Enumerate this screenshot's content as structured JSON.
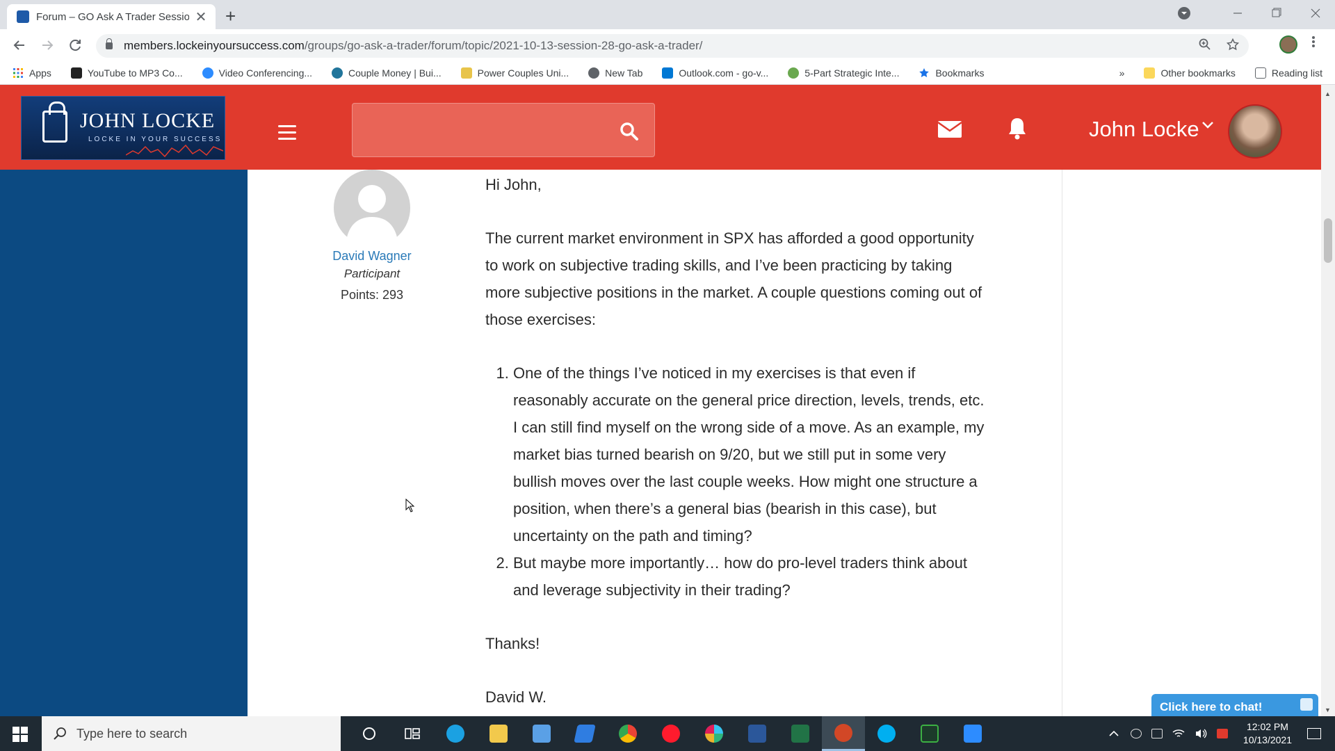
{
  "browser": {
    "tab_title": "Forum – GO Ask A Trader Session",
    "new_tab_symbol": "+",
    "close_symbol": "✕",
    "url_host": "members.lockeinyoursuccess.com",
    "url_path": "/groups/go-ask-a-trader/forum/topic/2021-10-13-session-28-go-ask-a-trader/",
    "bookmarks": [
      {
        "label": "Apps",
        "color": "#4285f4"
      },
      {
        "label": "YouTube to MP3 Co...",
        "color": "#222222"
      },
      {
        "label": "Video Conferencing...",
        "color": "#2d8cff"
      },
      {
        "label": "Couple Money | Bui...",
        "color": "#21759b"
      },
      {
        "label": "Power Couples Uni...",
        "color": "#e8c44a"
      },
      {
        "label": "New Tab",
        "color": "#5f6368"
      },
      {
        "label": "Outlook.com - go-v...",
        "color": "#0078d4"
      },
      {
        "label": "5-Part Strategic Inte...",
        "color": "#6aa84f"
      },
      {
        "label": "Bookmarks",
        "color": "#1a73e8"
      }
    ],
    "bookmarks_overflow": "»",
    "other_bookmarks": "Other bookmarks",
    "reading_list": "Reading list"
  },
  "site": {
    "logo_name": "JOHN LOCKE",
    "logo_tagline": "LOCKE IN YOUR SUCCESS",
    "user_name": "John Locke",
    "brand_color": "#e03a2d",
    "sidebar_color": "#0c4a82"
  },
  "post": {
    "author_name": "David Wagner",
    "author_role": "Participant",
    "author_points": "Points: 293",
    "greeting": "Hi John,",
    "intro": "The current market environment in SPX has afforded a good opportunity to work on subjective trading skills, and I’ve been practicing by taking more subjective positions in the market.  A couple questions coming out of those exercises:",
    "questions": [
      "One of the things I’ve noticed in my exercises is that even if reasonably accurate on the general price direction, levels, trends, etc. I can still find myself on the wrong side of a move.  As an example, my market bias turned bearish on 9/20, but we still put in some very bullish moves over the last couple weeks.  How might one structure a position, when there’s a general bias (bearish in this case), but uncertainty on the path and timing?",
      "But maybe more importantly… how do pro-level traders think about and leverage subjectivity in their trading?"
    ],
    "thanks": "Thanks!",
    "signature": "David W."
  },
  "chat": {
    "label": "Click here to chat!"
  },
  "taskbar": {
    "search_placeholder": "Type here to search",
    "time": "12:02 PM",
    "date": "10/13/2021",
    "apps": [
      {
        "name": "cortana-icon",
        "color": "#ffffff"
      },
      {
        "name": "task-view-icon",
        "color": "#ffffff"
      },
      {
        "name": "edge-icon",
        "color": "#1ba1e2"
      },
      {
        "name": "file-explorer-icon",
        "color": "#f2c94c"
      },
      {
        "name": "notepad-app-icon",
        "color": "#5aa0e6"
      },
      {
        "name": "todo-icon",
        "color": "#2f7de1"
      },
      {
        "name": "chrome-icon",
        "color": "#e8453c"
      },
      {
        "name": "opera-icon",
        "color": "#ff1b2d"
      },
      {
        "name": "slack-icon",
        "color": "#ecb22e"
      },
      {
        "name": "word-icon",
        "color": "#2b579a"
      },
      {
        "name": "excel-icon",
        "color": "#217346"
      },
      {
        "name": "powerpoint-icon",
        "color": "#d24726"
      },
      {
        "name": "skype-icon",
        "color": "#00aff0"
      },
      {
        "name": "trading-app-icon",
        "color": "#3cb043"
      },
      {
        "name": "zoom-icon",
        "color": "#2d8cff"
      }
    ]
  }
}
